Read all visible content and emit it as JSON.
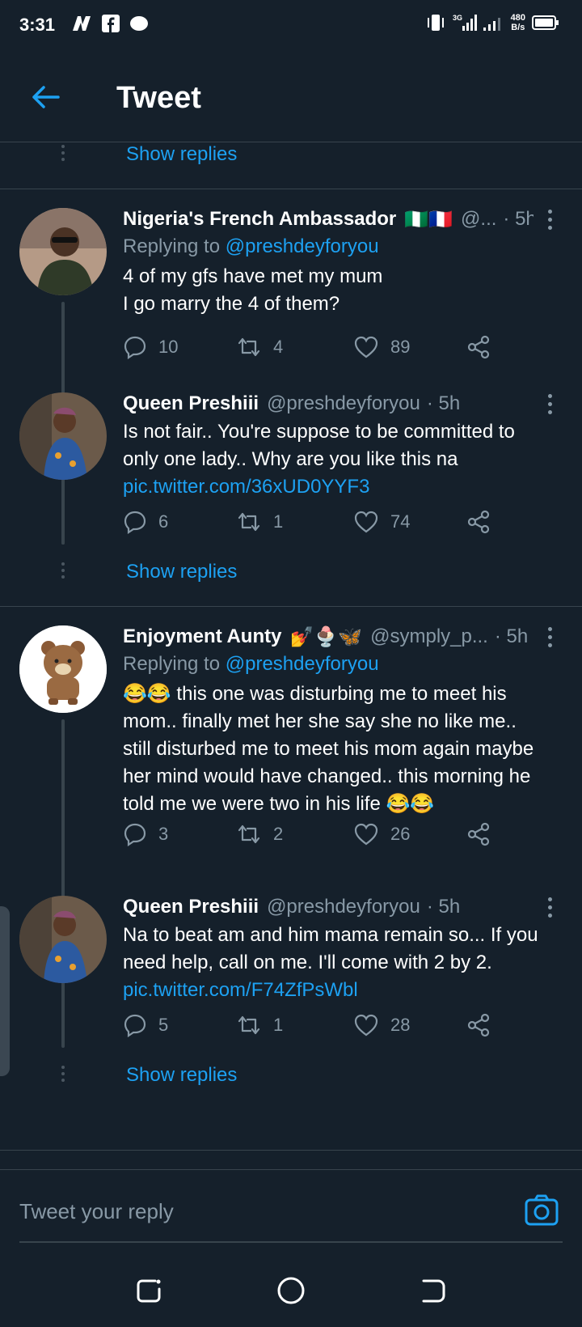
{
  "status_bar": {
    "time": "3:31",
    "net_speed_value": "480",
    "net_speed_unit": "B/s",
    "network_label": "3G"
  },
  "header": {
    "title": "Tweet"
  },
  "top": {
    "show_replies": "Show replies"
  },
  "tweets": [
    {
      "name": "Nigeria's French Ambassador",
      "flags": "🇳🇬🇫🇷",
      "handle": "@...",
      "time": "· 5h",
      "replying_prefix": "Replying to",
      "replying_handle": "@preshdeyforyou",
      "text_lines": [
        "4 of my gfs have met my mum",
        "I go marry the 4 of them?"
      ],
      "replies": "10",
      "retweets": "4",
      "likes": "89"
    },
    {
      "name": "Queen Preshiii",
      "handle": "@preshdeyforyou",
      "time": "· 5h",
      "text_lines": [
        "Is not fair.. You're suppose to be committed to",
        "only one lady.. Why are you like this na"
      ],
      "link": "pic.twitter.com/36xUD0YYF3",
      "replies": "6",
      "retweets": "1",
      "likes": "74"
    },
    {
      "name": "Enjoyment Aunty",
      "name_emoji": "💅🍨🦋",
      "handle": "@symply_p...",
      "time": "· 5h",
      "replying_prefix": "Replying to",
      "replying_handle": "@preshdeyforyou",
      "text_lines": [
        "😂😂 this one was disturbing me to meet his",
        "mom.. finally met her she say she no like me..",
        "still disturbed me to meet his mom again maybe",
        "her mind would have changed.. this morning he",
        "told me we were two in his life 😂😂"
      ],
      "replies": "3",
      "retweets": "2",
      "likes": "26"
    },
    {
      "name": "Queen Preshiii",
      "handle": "@preshdeyforyou",
      "time": "· 5h",
      "text_lines": [
        "Na to beat am and him mama remain so... If you",
        "need help, call on me. I'll come with 2 by 2."
      ],
      "link": "pic.twitter.com/F74ZfPsWbl",
      "replies": "5",
      "retweets": "1",
      "likes": "28"
    }
  ],
  "show_replies_1": "Show replies",
  "show_replies_2": "Show replies",
  "composer": {
    "placeholder": "Tweet your reply"
  },
  "colors": {
    "background": "#15202b",
    "accent": "#1da1f2",
    "muted": "#8899a6",
    "border": "#38444d"
  }
}
